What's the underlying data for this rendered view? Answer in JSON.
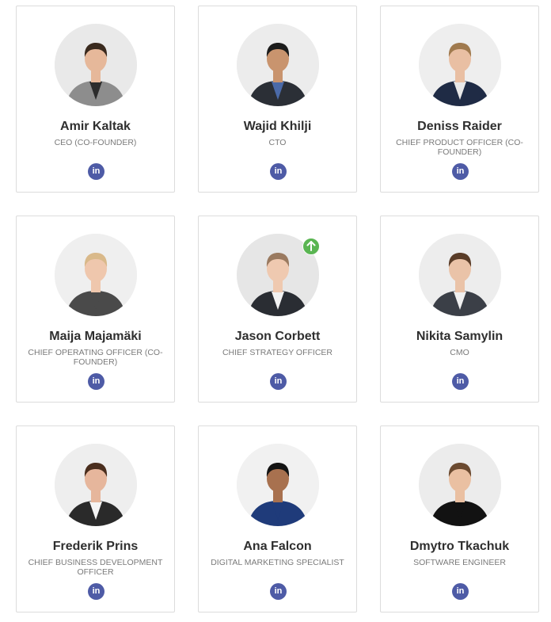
{
  "team": {
    "members": [
      {
        "name": "Amir Kaltak",
        "role": "CEO (CO-FOUNDER)",
        "linkedin_label": "in",
        "avatar_bg": "#e9e9e9",
        "suit": "#8d8d8d",
        "shirt": "#2c2c2c",
        "skin": "#e6b89a",
        "hair": "#3a2a1e"
      },
      {
        "name": "Wajid Khilji",
        "role": "CTO",
        "linkedin_label": "in",
        "avatar_bg": "#ececec",
        "suit": "#2b2f36",
        "shirt": "#4b6aa8",
        "skin": "#c9946e",
        "hair": "#1c1c1c"
      },
      {
        "name": "Deniss Raider",
        "role": "CHIEF PRODUCT OFFICER (CO-FOUNDER)",
        "linkedin_label": "in",
        "avatar_bg": "#eeeeee",
        "suit": "#1f2b45",
        "shirt": "#e8e8e8",
        "skin": "#e9bfa3",
        "hair": "#a07a4e"
      },
      {
        "name": "Maija Majamäki",
        "role": "CHIEF OPERATING OFFICER (CO-FOUNDER)",
        "linkedin_label": "in",
        "avatar_bg": "#efefef",
        "suit": "#4a4a4a",
        "shirt": "#4a4a4a",
        "skin": "#efc7ad",
        "hair": "#d9b98a"
      },
      {
        "name": "Jason Corbett",
        "role": "CHIEF STRATEGY OFFICER",
        "linkedin_label": "in",
        "avatar_bg": "#e6e6e6",
        "suit": "#2a2d33",
        "shirt": "#f2f2f2",
        "skin": "#efc9b0",
        "hair": "#9a7a60"
      },
      {
        "name": "Nikita Samylin",
        "role": "CMO",
        "linkedin_label": "in",
        "avatar_bg": "#ededed",
        "suit": "#3b3f47",
        "shirt": "#f0f0f0",
        "skin": "#eac3a8",
        "hair": "#5a3d28"
      },
      {
        "name": "Frederik Prins",
        "role": "CHIEF BUSINESS DEVELOPMENT OFFICER",
        "linkedin_label": "in",
        "avatar_bg": "#eeeeee",
        "suit": "#2a2a2a",
        "shirt": "#f4f4f4",
        "skin": "#e6b69c",
        "hair": "#4a2e1e"
      },
      {
        "name": "Ana Falcon",
        "role": "DIGITAL MARKETING SPECIALIST",
        "linkedin_label": "in",
        "avatar_bg": "#f1f1f1",
        "suit": "#1f3b7a",
        "shirt": "#1f3b7a",
        "skin": "#a8714f",
        "hair": "#141414"
      },
      {
        "name": "Dmytro Tkachuk",
        "role": "SOFTWARE ENGINEER",
        "linkedin_label": "in",
        "avatar_bg": "#ececec",
        "suit": "#121212",
        "shirt": "#121212",
        "skin": "#eac0a2",
        "hair": "#6b4a30"
      }
    ]
  },
  "colors": {
    "linkedin_bg": "#4e5ba6",
    "badge_bg": "#5ab552",
    "name_text": "#2f2f2f",
    "role_text": "#7a7a7a",
    "card_border": "#dcdcdc"
  },
  "icons": {
    "linkedin": "linkedin-icon",
    "badge": "arrow-up-icon"
  }
}
